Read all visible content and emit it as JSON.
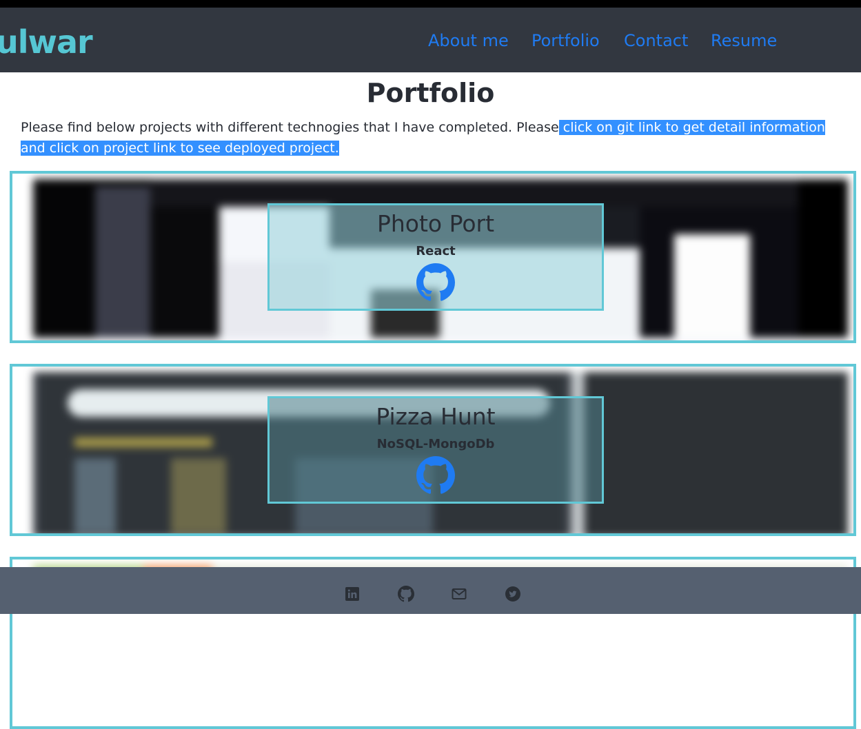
{
  "header": {
    "brand": "ulwar",
    "nav": [
      "About me",
      "Portfolio",
      "Contact",
      "Resume"
    ]
  },
  "main": {
    "title": "Portfolio",
    "intro_plain": "Please find below projects with different technogies that I have completed. Please",
    "intro_selected": " click on git link to get detail information and click on project link to see deployed project.",
    "projects": [
      {
        "name": "Photo Port",
        "tech": "React",
        "link_icon": "github-icon"
      },
      {
        "name": "Pizza Hunt",
        "tech": "NoSQL-MongoDb",
        "link_icon": "github-icon"
      }
    ]
  },
  "footer": {
    "icons": [
      "linkedin-icon",
      "github-icon",
      "mail-icon",
      "twitter-icon"
    ]
  },
  "colors": {
    "accent": "#61c8d6",
    "link": "#1f7bf2",
    "header_bg": "#323740",
    "footer_bg": "#556070",
    "selection": "#3390ff"
  }
}
